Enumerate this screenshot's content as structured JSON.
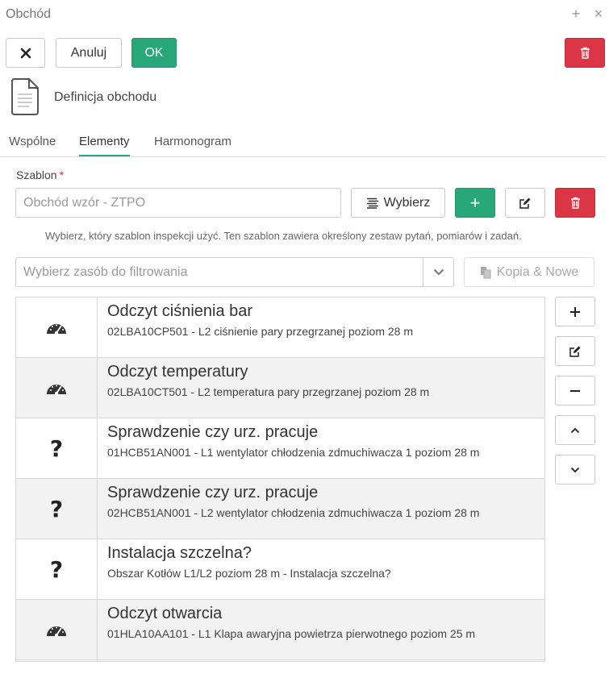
{
  "window": {
    "title": "Obchód",
    "plus_icon": "plus-icon",
    "close_icon": "close-icon"
  },
  "toolbar": {
    "close_icon": "x-icon",
    "cancel_label": "Anuluj",
    "ok_label": "OK",
    "delete_icon": "trash-icon"
  },
  "header": {
    "doc_icon": "document-icon",
    "title": "Definicja obchodu"
  },
  "tabs": [
    {
      "label": "Wspólne",
      "active": false
    },
    {
      "label": "Elementy",
      "active": true
    },
    {
      "label": "Harmonogram",
      "active": false
    }
  ],
  "template": {
    "label": "Szablon",
    "required_mark": "*",
    "placeholder": "Obchód wzór - ZTPO",
    "choose_label": "Wybierz",
    "hint": "Wybierz, który szablon inspekcji użyć. Ten szablon zawiera określony zestaw pytań, pomiarów i zadań."
  },
  "filter": {
    "placeholder": "Wybierz zasób do filtrowania",
    "copy_label": "Kopia & Nowe"
  },
  "items": [
    {
      "icon": "gauge-icon",
      "title": "Odczyt ciśnienia bar",
      "subtitle": "02LBA10CP501 - L2 ciśnienie pary przegrzanej poziom 28 m"
    },
    {
      "icon": "gauge-icon",
      "title": "Odczyt temperatury",
      "subtitle": "02LBA10CT501 - L2 temperatura pary przegrzanej poziom 28 m"
    },
    {
      "icon": "question-icon",
      "title": "Sprawdzenie czy urz. pracuje",
      "subtitle": "01HCB51AN001 - L1 wentylator chłodzenia zdmuchiwacza 1 poziom 28 m"
    },
    {
      "icon": "question-icon",
      "title": "Sprawdzenie czy urz. pracuje",
      "subtitle": "02HCB51AN001 - L2 wentylator chłodzenia zdmuchiwacza 1 poziom 28 m"
    },
    {
      "icon": "question-icon",
      "title": "Instalacja szczelna?",
      "subtitle": "Obszar Kotłów L1/L2 poziom 28 m - Instalacja szczelna?"
    },
    {
      "icon": "gauge-icon",
      "title": "Odczyt otwarcia",
      "subtitle": "01HLA10AA101 - L1 Klapa awaryjna powietrza pierwotnego poziom 25 m"
    }
  ],
  "colors": {
    "accent_green": "#28a77a",
    "danger_red": "#dc3545",
    "row_alt": "#f2f2f2"
  }
}
